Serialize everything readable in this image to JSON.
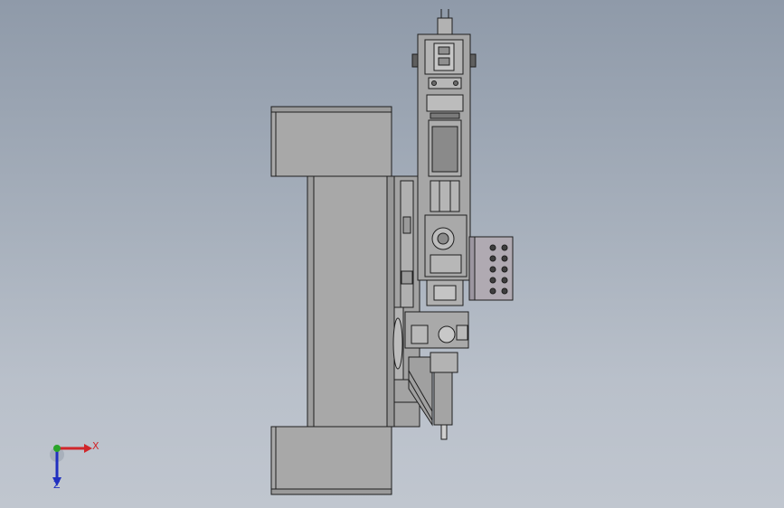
{
  "triad": {
    "x_label": "X",
    "z_label": "Z",
    "x_color": "#d0262a",
    "y_color": "#2aa52a",
    "z_color": "#2030c0"
  },
  "model": {
    "body_color": "#a8a8a8",
    "shade_color": "#939393",
    "edge_color": "#1e1e1e",
    "panel_color": "#b0aab2"
  }
}
